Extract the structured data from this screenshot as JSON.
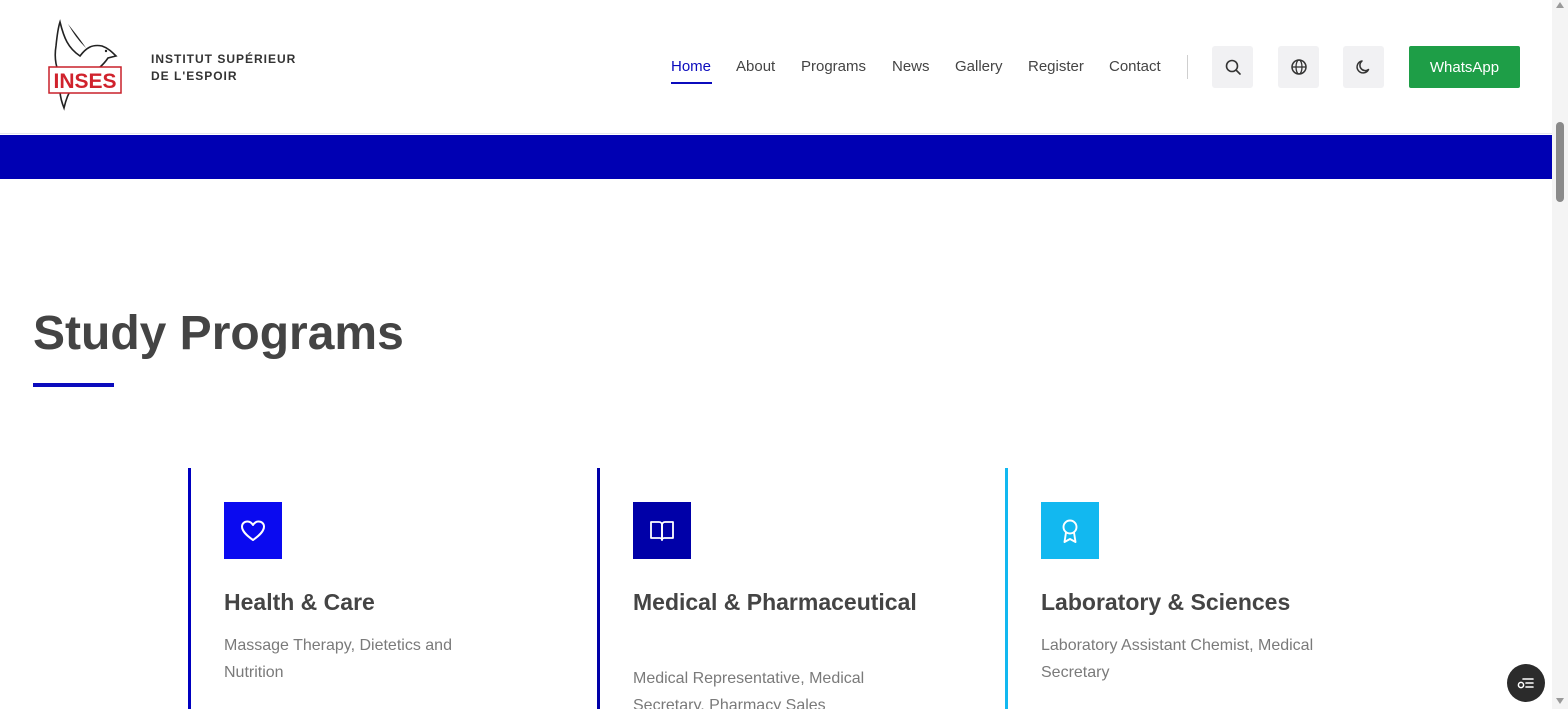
{
  "brand": {
    "logo_text": "INSES",
    "name_line1": "INSTITUT SUPÉRIEUR",
    "name_line2": "DE L'ESPOIR"
  },
  "nav": {
    "items": [
      {
        "label": "Home",
        "active": true
      },
      {
        "label": "About"
      },
      {
        "label": "Programs"
      },
      {
        "label": "News"
      },
      {
        "label": "Gallery"
      },
      {
        "label": "Register"
      },
      {
        "label": "Contact"
      }
    ],
    "icons": [
      "search-icon",
      "globe-icon",
      "moon-icon"
    ],
    "whatsapp_label": "WhatsApp"
  },
  "colors": {
    "primary": "#0b0bbd",
    "band": "#0000b3",
    "whatsapp": "#1e9e47",
    "card1": "#0a0af0",
    "card2": "#0000a8",
    "card3": "#12b8f0"
  },
  "section": {
    "title": "Study Programs"
  },
  "programs": [
    {
      "icon": "heart-icon",
      "title": "Health & Care",
      "desc": "Massage Therapy, Dietetics and Nutrition"
    },
    {
      "icon": "book-icon",
      "title": "Medical & Pharmaceutical",
      "desc": "Medical Representative, Medical Secretary, Pharmacy Sales"
    },
    {
      "icon": "award-icon",
      "title": "Laboratory & Sciences",
      "desc": "Laboratory Assistant Chemist, Medical Secretary"
    }
  ]
}
